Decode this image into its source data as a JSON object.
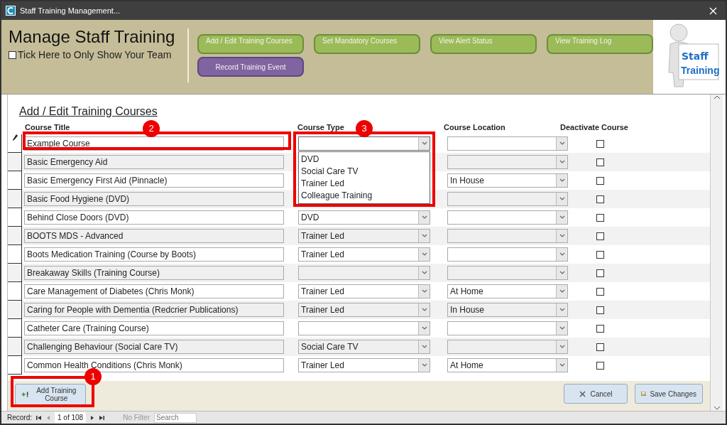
{
  "window": {
    "title": "Staff Training Management..."
  },
  "header": {
    "title": "Manage Staff Training",
    "team_filter": {
      "label": "Tick Here to Only Show Your Team",
      "checked": false
    },
    "buttons": [
      {
        "label": "Add / Edit Training Courses",
        "kind": "nav"
      },
      {
        "label": "Set Mandatory Courses",
        "kind": "nav"
      },
      {
        "label": "View Alert Status",
        "kind": "nav"
      },
      {
        "label": "View Training Log",
        "kind": "nav"
      },
      {
        "label": "Record Training Event",
        "kind": "action"
      }
    ],
    "logo": {
      "line1": "Staff",
      "line2": "Training"
    }
  },
  "form": {
    "title": "Add / Edit Training Courses",
    "columns": [
      "Course Title",
      "Course Type",
      "Course Location",
      "Deactivate Course"
    ],
    "rows": [
      {
        "title": "Example Course",
        "type": "",
        "location": "",
        "deactivated": false,
        "editing": true
      },
      {
        "title": "Basic Emergency Aid",
        "type": "",
        "location": "",
        "deactivated": false,
        "editing": false
      },
      {
        "title": "Basic Emergency First Aid (Pinnacle)",
        "type": "",
        "location": "In House",
        "deactivated": false,
        "editing": false
      },
      {
        "title": "Basic Food Hygiene (DVD)",
        "type": "",
        "location": "",
        "deactivated": false,
        "editing": false
      },
      {
        "title": "Behind Close Doors (DVD)",
        "type": "DVD",
        "location": "",
        "deactivated": false,
        "editing": false
      },
      {
        "title": "BOOTS MDS - Advanced",
        "type": "Trainer Led",
        "location": "",
        "deactivated": false,
        "editing": false
      },
      {
        "title": "Boots Medication Training (Course by Boots)",
        "type": "Trainer Led",
        "location": "",
        "deactivated": false,
        "editing": false
      },
      {
        "title": "Breakaway Skills (Training Course)",
        "type": "",
        "location": "",
        "deactivated": false,
        "editing": false
      },
      {
        "title": "Care Management of Diabetes (Chris Monk)",
        "type": "Trainer Led",
        "location": "At Home",
        "deactivated": false,
        "editing": false
      },
      {
        "title": "Caring for People with Dementia (Redcrier Publications)",
        "type": "Trainer Led",
        "location": "In House",
        "deactivated": false,
        "editing": false
      },
      {
        "title": "Catheter Care (Training Course)",
        "type": "",
        "location": "",
        "deactivated": false,
        "editing": false
      },
      {
        "title": "Challenging Behaviour (Social Care TV)",
        "type": "Social Care TV",
        "location": "",
        "deactivated": false,
        "editing": false
      },
      {
        "title": "Common Health Conditions (Chris Monk)",
        "type": "Trainer Led",
        "location": "At Home",
        "deactivated": false,
        "editing": false
      }
    ],
    "dropdown_options": [
      "DVD",
      "Social Care TV",
      "Trainer Led",
      "Colleague Training"
    ],
    "footer_buttons": [
      {
        "label": "Add Training Course",
        "kind": "add"
      },
      {
        "label": "Cancel",
        "kind": "cancel"
      },
      {
        "label": "Save Changes",
        "kind": "save"
      }
    ]
  },
  "annotations": [
    "1",
    "2",
    "3"
  ],
  "record_nav": {
    "label": "Record:",
    "position": "1 of 108",
    "filter": "No Filter",
    "search_placeholder": "Search"
  }
}
